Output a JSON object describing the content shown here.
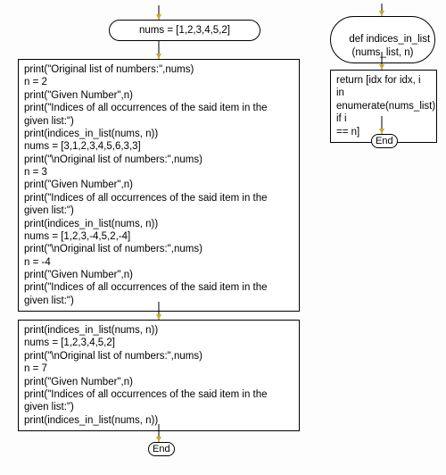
{
  "left": {
    "start_label": "nums = [1,2,3,4,5,2]",
    "box1_lines": [
      "print(\"Original list of numbers:\",nums)",
      "n = 2",
      "print(\"Given Number\",n)",
      "print(\"Indices of all occurrences of the said item in the given list:\")",
      "print(indices_in_list(nums, n))",
      "nums = [3,1,2,3,4,5,6,3,3]",
      "print(\"\\nOriginal list of numbers:\",nums)",
      "n = 3",
      "print(\"Given Number\",n)",
      "print(\"Indices of all occurrences of the said item in the given list:\")",
      "print(indices_in_list(nums, n))",
      "nums = [1,2,3,-4,5,2,-4]",
      "print(\"\\nOriginal list of numbers:\",nums)",
      "n = -4",
      "print(\"Given Number\",n)",
      "print(\"Indices of all occurrences of the said item in the given list:\")"
    ],
    "box2_lines": [
      "print(indices_in_list(nums, n))",
      "nums = [1,2,3,4,5,2]",
      "print(\"\\nOriginal list of numbers:\",nums)",
      "n = 7",
      "print(\"Given Number\",n)",
      "print(\"Indices of all occurrences of the said item in the given list:\")",
      "print(indices_in_list(nums, n))"
    ],
    "end_label": "End"
  },
  "right": {
    "fn_label": "def indices_in_list\n(nums_list, n)",
    "body_lines": [
      "return [idx for idx, i in",
      "enumerate(nums_list) if i",
      "== n]"
    ],
    "end_label": "End"
  }
}
